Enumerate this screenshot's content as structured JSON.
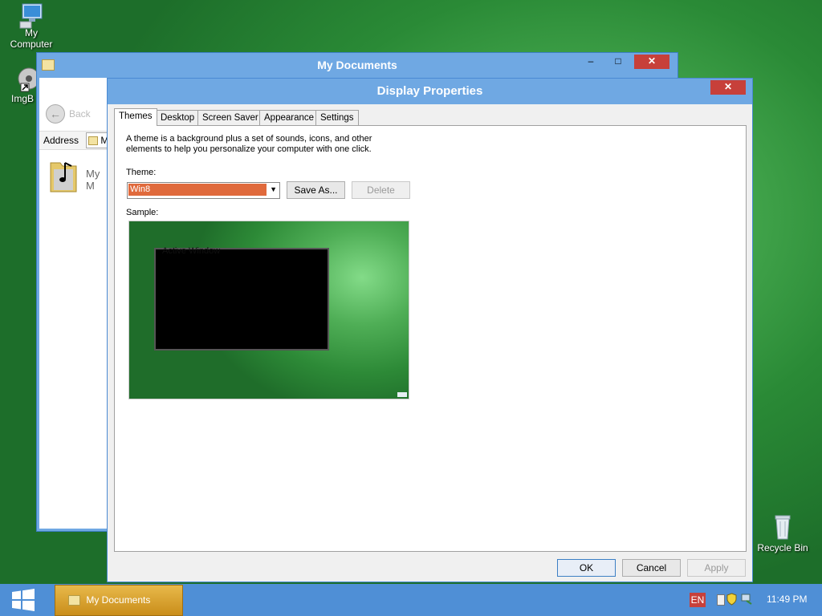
{
  "desktop": {
    "icons": [
      {
        "label": "My\nComputer"
      },
      {
        "label": "ImgB"
      },
      {
        "label": "Recycle Bin"
      }
    ]
  },
  "mydocs": {
    "title": "My Documents",
    "back_label": "Back",
    "address_label": "Address",
    "address_value": "M",
    "item_label": "My M"
  },
  "display": {
    "title": "Display Properties",
    "tabs": [
      "Themes",
      "Desktop",
      "Screen Saver",
      "Appearance",
      "Settings"
    ],
    "description": "A theme is a background plus a set of sounds, icons, and other elements to help you personalize your computer with one click.",
    "theme_label": "Theme:",
    "theme_value": "Win8",
    "save_as_label": "Save As...",
    "delete_label": "Delete",
    "sample_label": "Sample:",
    "sample_window_title": "Active Window",
    "ok_label": "OK",
    "cancel_label": "Cancel",
    "apply_label": "Apply"
  },
  "taskbar": {
    "task_label": "My Documents",
    "lang": "EN",
    "clock": "11:49 PM"
  },
  "colors": {
    "accent": "#6fa8e3",
    "close": "#c7403a",
    "selection": "#e06a3c",
    "taskbar": "#4f8fd6",
    "task_active": "#e0a838"
  }
}
